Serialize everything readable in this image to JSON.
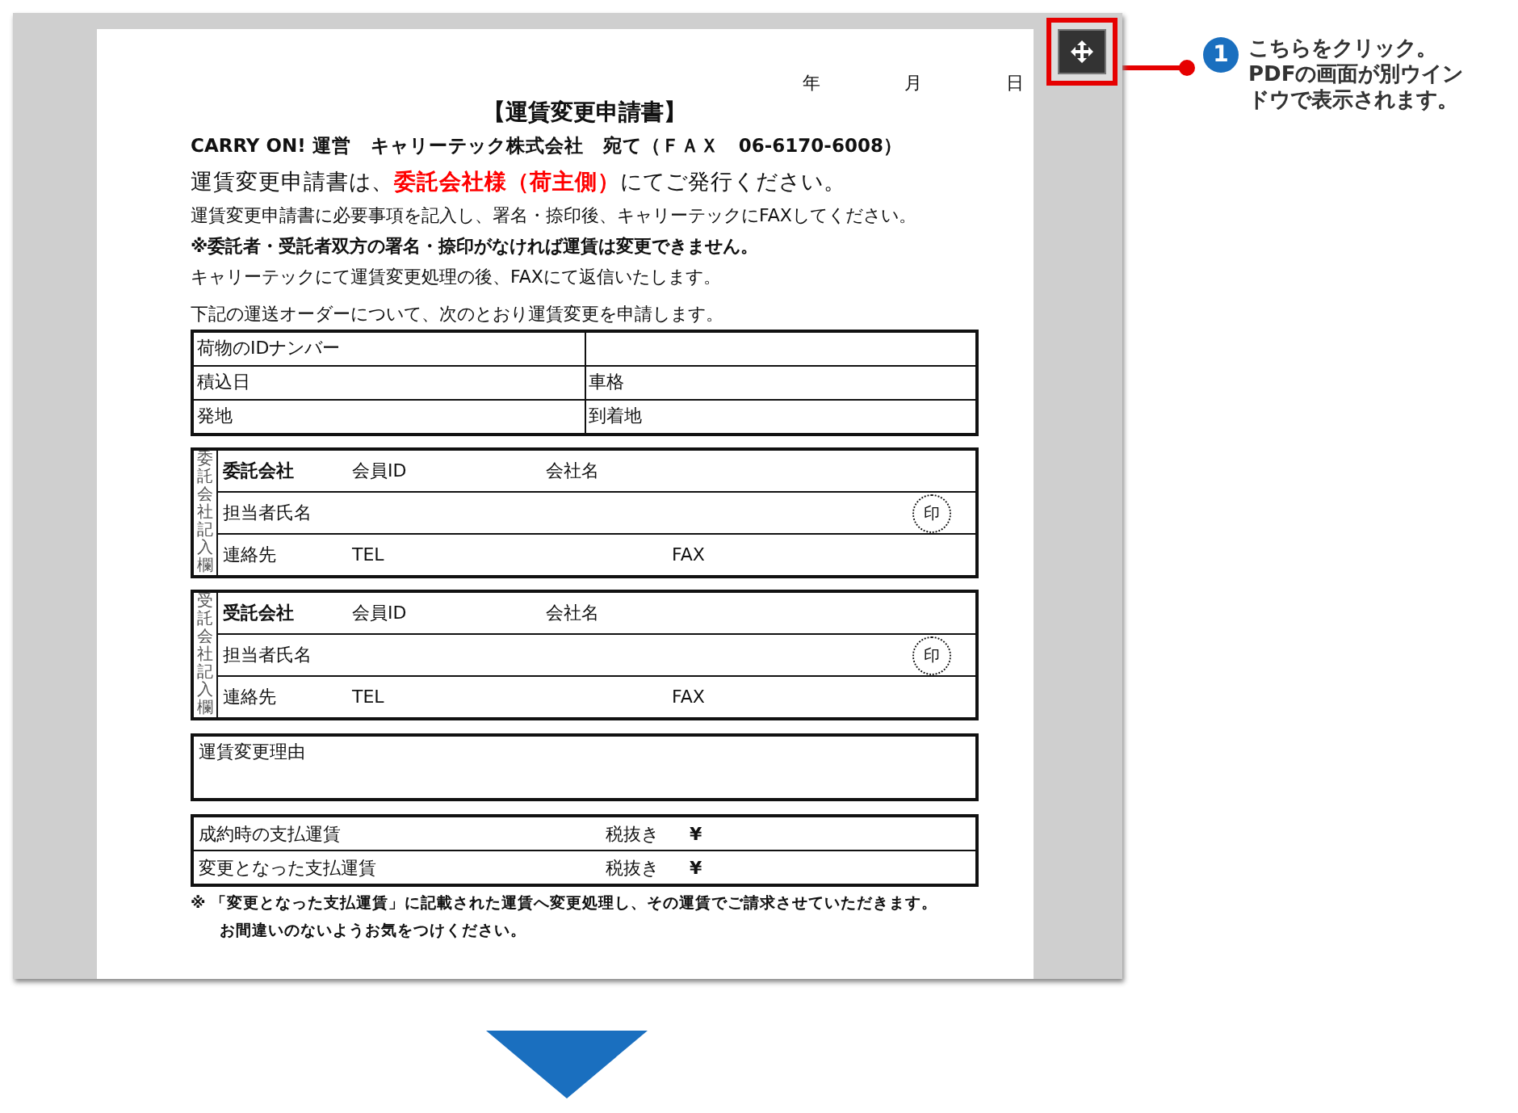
{
  "viewer": {
    "date_labels": [
      "年",
      "月",
      "日"
    ],
    "title": "【運賃変更申請書】",
    "addressee": "CARRY ON! 運営　キャリーテック株式会社　宛て（ＦＡＸ　06-6170-6008）",
    "lead": "運賃変更申請書は、**委託会社様（荷主側）**にてご発行ください。",
    "instructions": [
      {
        "text": "運賃変更申請書に必要事項を記入し、署名・捺印後、キャリーテックにFAXしてください。",
        "bold": false
      },
      {
        "text": "※委託者・受託者双方の署名・捺印がなければ運賃は変更できません。",
        "bold": true
      },
      {
        "text": "キャリーテックにて運賃変更処理の後、FAXにて返信いたします。",
        "bold": false
      }
    ],
    "intro": "下記の運送オーダーについて、次のとおり運賃変更を申請します。",
    "order_rows": [
      {
        "left": "荷物のIDナンバー"
      },
      {
        "left": "積込日",
        "right": "車格"
      },
      {
        "left": "発地",
        "right": "到着地"
      }
    ],
    "parties": [
      {
        "side_label": "委託会社記入欄",
        "role": "委託会社",
        "member_id_label": "会員ID",
        "company_label": "会社名",
        "person_label": "担当者氏名",
        "seal": "印",
        "contact_label": "連絡先",
        "tel_label": "TEL",
        "fax_label": "FAX"
      },
      {
        "side_label": "受託会社記入欄",
        "role": "受託会社",
        "member_id_label": "会員ID",
        "company_label": "会社名",
        "person_label": "担当者氏名",
        "seal": "印",
        "contact_label": "連絡先",
        "tel_label": "TEL",
        "fax_label": "FAX"
      }
    ],
    "reason_label": "運賃変更理由",
    "fares": [
      {
        "label": "成約時の支払運賃",
        "tax": "税抜き",
        "currency": "¥"
      },
      {
        "label": "変更となった支払運賃",
        "tax": "税抜き",
        "currency": "¥"
      }
    ],
    "notes": [
      "※ 「変更となった支払運賃」に記載された運賃へ変更処理し、その運賃でご請求させていただきます。",
      "お間違いのないようお気をつけください。"
    ]
  },
  "callout": {
    "number": "1",
    "text": "こちらをクリック。PDFの画面が別ウインドウで表示されます。"
  }
}
